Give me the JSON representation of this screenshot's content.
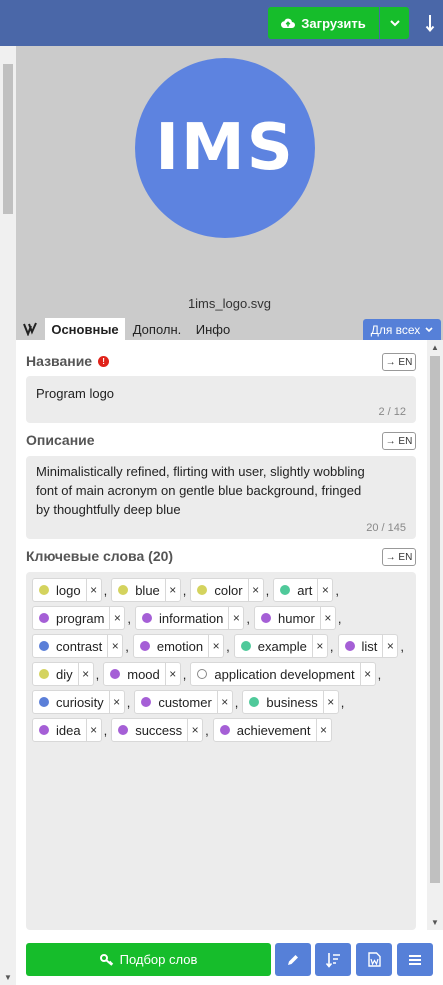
{
  "toolbar": {
    "upload_label": "Загрузить"
  },
  "preview": {
    "logo_text": "IMS",
    "logo_color": "#5d83e0",
    "filename": "1ims_logo.svg"
  },
  "tabs": {
    "items": [
      "Основные",
      "Дополн.",
      "Инфо"
    ],
    "for_all_label": "Для всех"
  },
  "fields": {
    "title": {
      "label": "Название",
      "value": "Program logo",
      "counter": "2 / 12",
      "translate_label": "→ EN"
    },
    "description": {
      "label": "Описание",
      "line1": "Minimalistically refined, flirting with user, slightly wobbling",
      "line2": "font of main acronym on gentle blue background, fringed",
      "line3": "by thoughtfully deep blue",
      "counter": "20 / 145",
      "translate_label": "→ EN"
    },
    "keywords": {
      "label": "Ключевые слова (20)",
      "translate_label": "→ EN",
      "items": [
        {
          "text": "logo",
          "color": "#d4d35e"
        },
        {
          "text": "blue",
          "color": "#d4d35e"
        },
        {
          "text": "color",
          "color": "#d4d35e"
        },
        {
          "text": "art",
          "color": "#4fc99a"
        },
        {
          "text": "program",
          "color": "#a55fd6"
        },
        {
          "text": "information",
          "color": "#a55fd6"
        },
        {
          "text": "humor",
          "color": "#a55fd6"
        },
        {
          "text": "contrast",
          "color": "#5b7fd8"
        },
        {
          "text": "emotion",
          "color": "#a55fd6"
        },
        {
          "text": "example",
          "color": "#4fc99a"
        },
        {
          "text": "list",
          "color": "#a55fd6"
        },
        {
          "text": "diy",
          "color": "#d4d35e"
        },
        {
          "text": "mood",
          "color": "#a55fd6"
        },
        {
          "text": "application development",
          "color": "#ffffff"
        },
        {
          "text": "curiosity",
          "color": "#5b7fd8"
        },
        {
          "text": "customer",
          "color": "#a55fd6"
        },
        {
          "text": "business",
          "color": "#4fc99a"
        },
        {
          "text": "idea",
          "color": "#a55fd6"
        },
        {
          "text": "success",
          "color": "#a55fd6"
        },
        {
          "text": "achievement",
          "color": "#a55fd6"
        }
      ]
    }
  },
  "bottom": {
    "pick_words_label": "Подбор слов"
  },
  "colors": {
    "topbar": "#4a67a8",
    "green": "#16bd2b",
    "accent_blue": "#5680d8",
    "required": "#e0231a"
  }
}
